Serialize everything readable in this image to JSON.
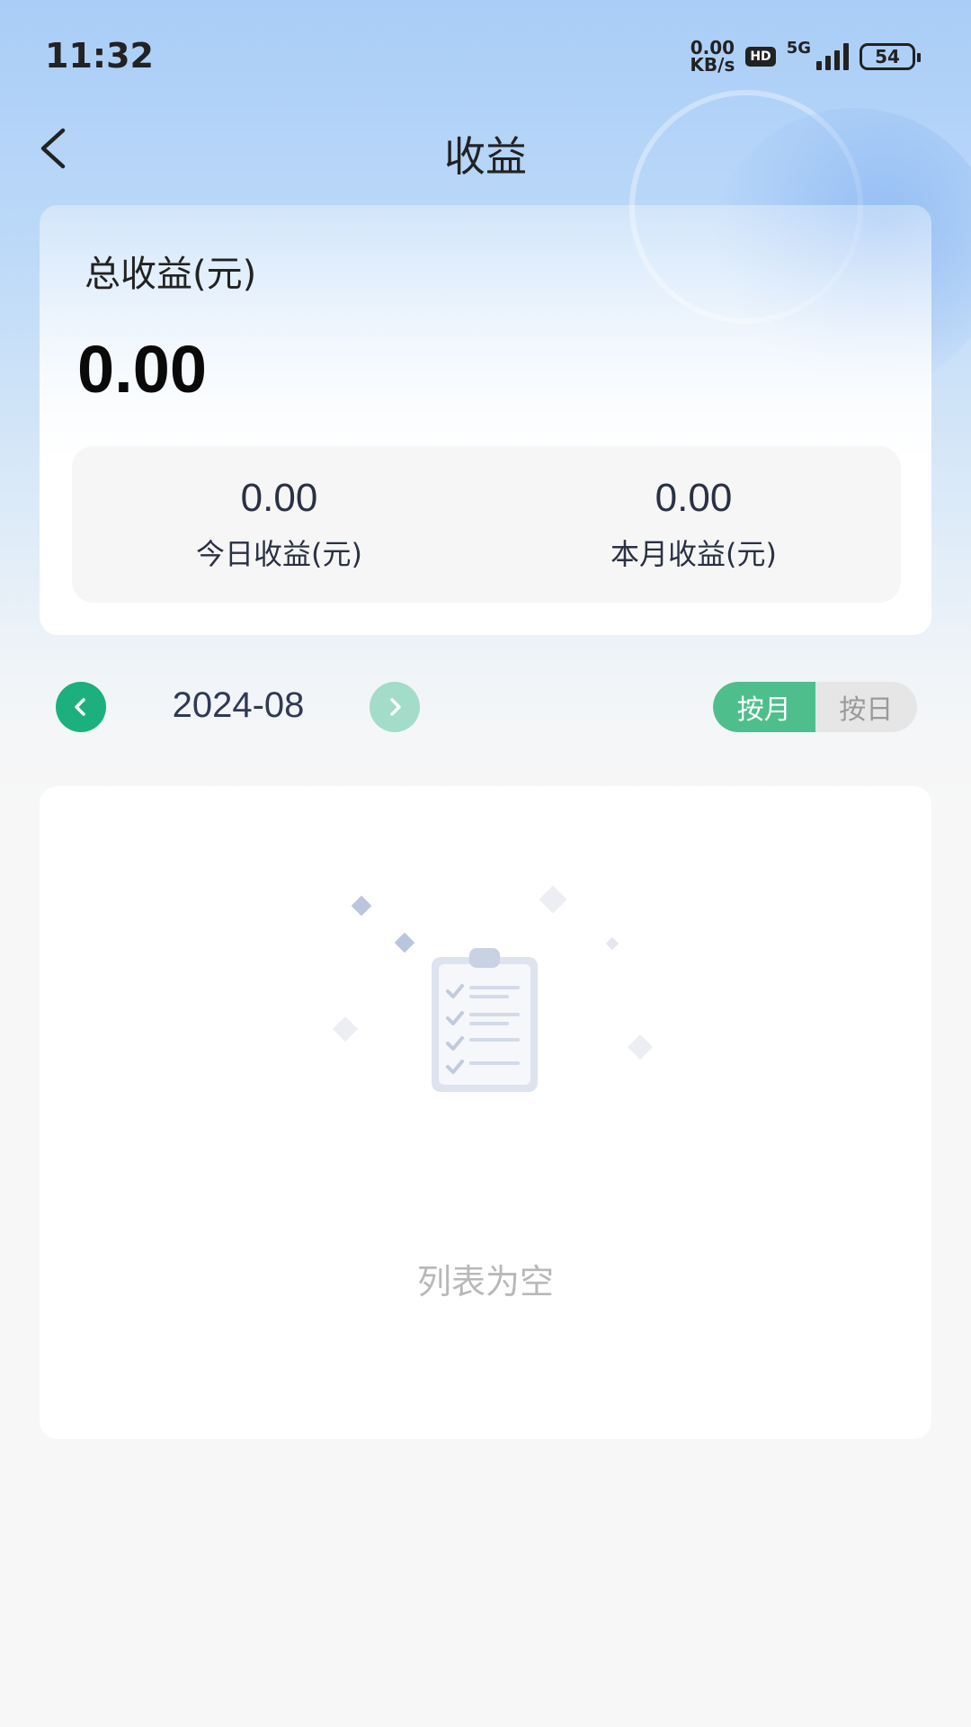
{
  "status_bar": {
    "time": "11:32",
    "net_speed_value": "0.00",
    "net_speed_unit": "KB/s",
    "hd_badge": "HD",
    "network": "5G",
    "battery": "54"
  },
  "header": {
    "title": "收益",
    "back_icon": "chevron-left-icon"
  },
  "summary": {
    "total_label": "总收益(元)",
    "total_value": "0.00",
    "today_value": "0.00",
    "today_label": "今日收益(元)",
    "month_value": "0.00",
    "month_label": "本月收益(元)"
  },
  "date_selector": {
    "date": "2024-08",
    "prev_icon": "chevron-left-icon",
    "next_icon": "chevron-right-icon",
    "prev_color": "#1cb07e",
    "next_color": "#a3dcc8"
  },
  "view_toggle": {
    "options": [
      "按月",
      "按日"
    ],
    "selected": "按月",
    "active_color": "#4ebf8c"
  },
  "list": {
    "empty_text": "列表为空",
    "empty_icon": "clipboard-checklist-icon"
  }
}
